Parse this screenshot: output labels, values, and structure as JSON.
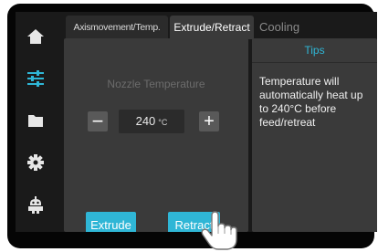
{
  "tabs": {
    "axis_label": "Axismovement/Temp.",
    "extrude_label": "Extrude/Retract",
    "cooling_label": "Cooling"
  },
  "sidebar": {
    "items": [
      {
        "icon": "home-icon"
      },
      {
        "icon": "sliders-icon"
      },
      {
        "icon": "folder-icon"
      },
      {
        "icon": "gear-icon"
      },
      {
        "icon": "robot-icon"
      }
    ]
  },
  "nozzle": {
    "label": "Nozzle Temperature",
    "value": "240",
    "unit": "°C",
    "minus_label": "−",
    "plus_label": "+"
  },
  "actions": {
    "extrude_label": "Extrude",
    "retract_label": "Retract"
  },
  "tips": {
    "title": "Tips",
    "text": "Temperature will automatically heat up to 240°C before feed/retreat"
  },
  "colors": {
    "accent": "#2fb6d6",
    "panel": "#3a3a3a",
    "background": "#1a1a1a"
  }
}
